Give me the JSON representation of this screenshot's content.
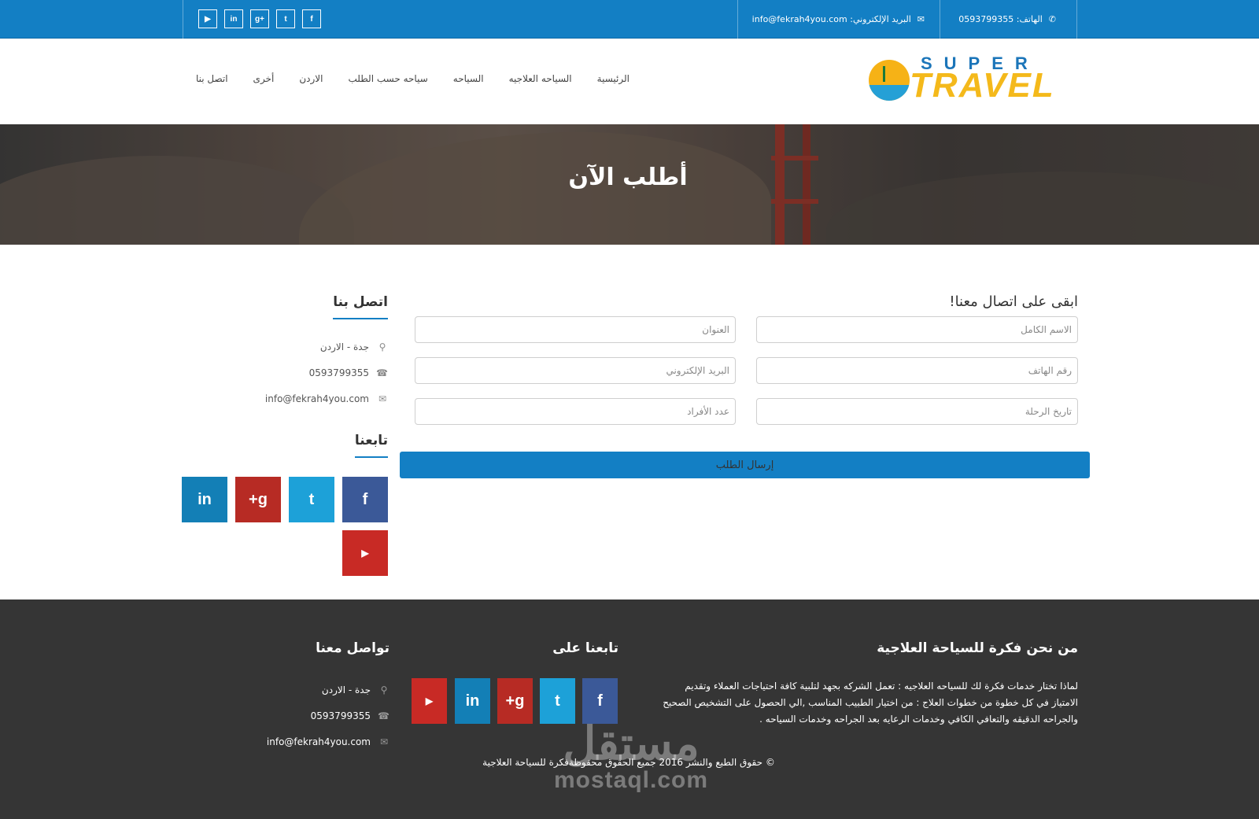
{
  "topbar": {
    "phone_label": "الهاتف: 0593799355",
    "email_label": "البريد الإلكتروني: info@fekrah4you.com",
    "socials": [
      "youtube-icon",
      "linkedin-icon",
      "google-plus-icon",
      "twitter-icon",
      "facebook-icon"
    ],
    "social_glyphs": [
      "▶",
      "in",
      "g+",
      "t",
      "f"
    ]
  },
  "logo": {
    "super": "SUPER",
    "travel": "TRAVEL"
  },
  "nav": {
    "items": [
      "الرئيسية",
      "السياحه العلاجيه",
      "السياحه",
      "سياحه حسب الطلب",
      "الاردن",
      "أخرى",
      "اتصل بنا"
    ]
  },
  "banner": {
    "title": "أطلب الآن"
  },
  "form": {
    "title": "ابقى على اتصال معنا!",
    "full_name": "الاسم الكامل",
    "address": "العنوان",
    "phone": "رقم الهاتف",
    "email": "البريد الإلكتروني",
    "trip_date": "تاريخ الرحلة",
    "people_count": "عدد الأفراد",
    "submit": "إرسال الطلب"
  },
  "contact": {
    "heading": "اتصل بنا",
    "location": "جدة - الاردن",
    "phone": "0593799355",
    "email": "info@fekrah4you.com",
    "follow_heading": "تابعنا"
  },
  "footer": {
    "about_heading": "من نحن فكرة للسياحة العلاجية",
    "about_text": "لماذا تختار خدمات فكرة لك للسياحه العلاجيه : تعمل الشركه بجهد لتلبية كافة احتياجات العملاء وتقديم الامتياز في كل خطوة من خطوات العلاج : من اختيار الطبيب المناسب ,الي الحصول على التشخيص الصحيح والجراحه الدقيقه والتعافي الكافي وخدمات الرعايه بعد الجراحه وخدمات السياحه .",
    "follow_heading": "تابعنا على",
    "connect_heading": "تواصل معنا",
    "location": "جدة - الاردن",
    "phone": "0593799355",
    "email": "info@fekrah4you.com",
    "copyright": "© حقوق الطبع والنشر 2016 جميع الحقوق محفوظةفكرة للسياحة العلاجية"
  },
  "watermark": {
    "ar": "مستقل",
    "en": "mostaql.com"
  },
  "colors": {
    "primary": "#137fc4",
    "footer": "#353535",
    "facebook": "#3b5998",
    "twitter": "#1da1d8",
    "google": "#b72b24",
    "linkedin": "#137fb6",
    "youtube": "#c82a25"
  }
}
